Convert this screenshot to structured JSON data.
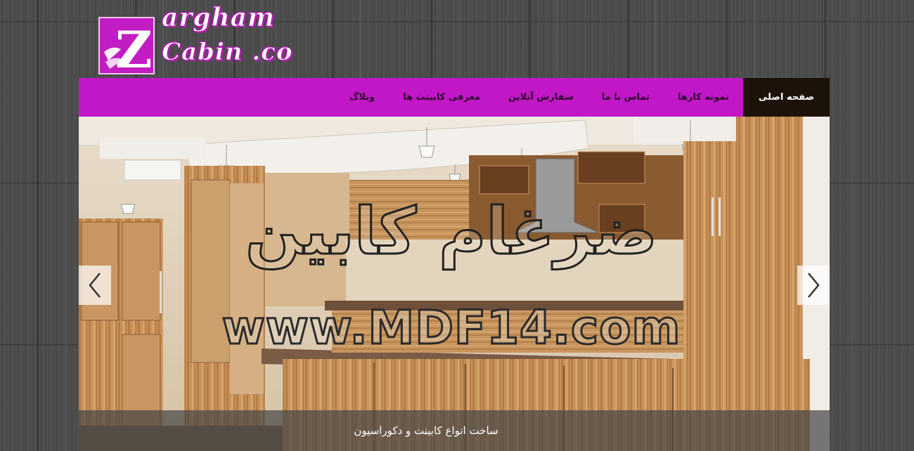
{
  "logo": {
    "line1": "argham",
    "line2": "Cabin .co",
    "letter": "Z"
  },
  "nav": {
    "items": [
      {
        "label": "صفحه اصلی",
        "active": true
      },
      {
        "label": "نمونه کارها",
        "active": false
      },
      {
        "label": "تماس با ما",
        "active": false
      },
      {
        "label": "سفارش آنلاین",
        "active": false
      },
      {
        "label": "معرفی کابینت ها",
        "active": false
      },
      {
        "label": "وبلاگ",
        "active": false
      }
    ]
  },
  "slider": {
    "watermark_name": "ضرغام کابین",
    "watermark_url": "www.MDF14.com",
    "caption": "ساخت انواع کابینت و دکوراسیون",
    "prev_icon": "chevron-left-icon",
    "next_icon": "chevron-right-icon"
  },
  "colors": {
    "brand": "#c117c6",
    "nav_active": "#1c1208",
    "background": "#4b4b4b"
  }
}
